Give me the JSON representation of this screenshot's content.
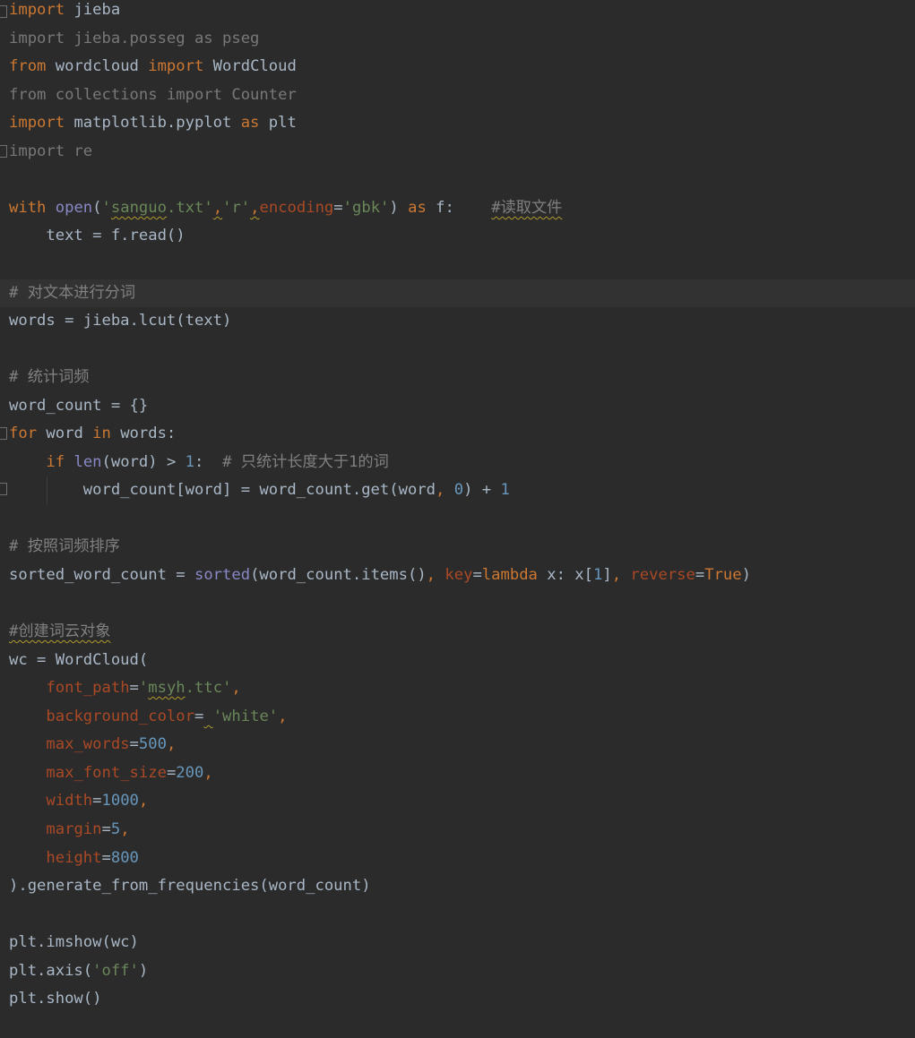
{
  "editor": {
    "colors": {
      "background": "#2b2b2b",
      "current_line": "#323232",
      "keyword": "#cc7832",
      "string": "#6a8759",
      "number": "#6897bb",
      "comment": "#808080",
      "builtin": "#8888c6",
      "param": "#aa4926",
      "default": "#a9b7c6"
    },
    "lines": [
      {
        "tokens": [
          {
            "t": "import",
            "c": "kw"
          },
          {
            "t": " jieba",
            "c": "def"
          }
        ]
      },
      {
        "tokens": [
          {
            "t": "import jieba.posseg as pseg",
            "c": "gray"
          }
        ]
      },
      {
        "tokens": [
          {
            "t": "from",
            "c": "kw"
          },
          {
            "t": " wordcloud ",
            "c": "def"
          },
          {
            "t": "import",
            "c": "kw"
          },
          {
            "t": " WordCloud",
            "c": "def"
          }
        ]
      },
      {
        "tokens": [
          {
            "t": "from collections import Counter",
            "c": "gray"
          }
        ]
      },
      {
        "tokens": [
          {
            "t": "import",
            "c": "kw"
          },
          {
            "t": " matplotlib.pyplot ",
            "c": "def"
          },
          {
            "t": "as",
            "c": "kw"
          },
          {
            "t": " plt",
            "c": "def"
          }
        ]
      },
      {
        "tokens": [
          {
            "t": "import re",
            "c": "gray"
          }
        ]
      },
      {
        "tokens": []
      },
      {
        "tokens": [
          {
            "t": "with",
            "c": "kw"
          },
          {
            "t": " ",
            "c": "def"
          },
          {
            "t": "open",
            "c": "builtin"
          },
          {
            "t": "(",
            "c": "def"
          },
          {
            "t": "'",
            "c": "str"
          },
          {
            "t": "sanguo",
            "c": "str",
            "s": true
          },
          {
            "t": ".txt'",
            "c": "str"
          },
          {
            "t": ",",
            "c": "kw",
            "s": true
          },
          {
            "t": "'r'",
            "c": "str"
          },
          {
            "t": ",",
            "c": "kw",
            "s": true
          },
          {
            "t": "encoding",
            "c": "param"
          },
          {
            "t": "=",
            "c": "def"
          },
          {
            "t": "'gbk'",
            "c": "str"
          },
          {
            "t": ") ",
            "c": "def"
          },
          {
            "t": "as",
            "c": "kw"
          },
          {
            "t": " f:    ",
            "c": "def"
          },
          {
            "t": "#读取文件",
            "c": "com",
            "s": true
          }
        ]
      },
      {
        "tokens": [
          {
            "t": "    text = f.read()",
            "c": "def"
          }
        ]
      },
      {
        "tokens": []
      },
      {
        "tokens": [
          {
            "t": "# 对文本进行分词",
            "c": "com"
          }
        ],
        "current": true
      },
      {
        "tokens": [
          {
            "t": "words = jieba.lcut(text)",
            "c": "def"
          }
        ]
      },
      {
        "tokens": []
      },
      {
        "tokens": [
          {
            "t": "# 统计词频",
            "c": "com"
          }
        ]
      },
      {
        "tokens": [
          {
            "t": "word_count = {}",
            "c": "def"
          }
        ]
      },
      {
        "tokens": [
          {
            "t": "for",
            "c": "kw"
          },
          {
            "t": " word ",
            "c": "def"
          },
          {
            "t": "in",
            "c": "kw"
          },
          {
            "t": " words:",
            "c": "def"
          }
        ]
      },
      {
        "tokens": [
          {
            "t": "    ",
            "c": "def"
          },
          {
            "t": "if",
            "c": "kw"
          },
          {
            "t": " ",
            "c": "def"
          },
          {
            "t": "len",
            "c": "builtin"
          },
          {
            "t": "(word) > ",
            "c": "def"
          },
          {
            "t": "1",
            "c": "num"
          },
          {
            "t": ":  ",
            "c": "def"
          },
          {
            "t": "# 只统计长度大于1的词",
            "c": "com"
          }
        ]
      },
      {
        "tokens": [
          {
            "t": "        word_count[word] = word_count.get(word",
            "c": "def"
          },
          {
            "t": ",",
            "c": "kw"
          },
          {
            "t": " ",
            "c": "def"
          },
          {
            "t": "0",
            "c": "num"
          },
          {
            "t": ") + ",
            "c": "def"
          },
          {
            "t": "1",
            "c": "num"
          }
        ]
      },
      {
        "tokens": []
      },
      {
        "tokens": [
          {
            "t": "# 按照词频排序",
            "c": "com"
          }
        ]
      },
      {
        "tokens": [
          {
            "t": "sorted_word_count = ",
            "c": "def"
          },
          {
            "t": "sorted",
            "c": "builtin"
          },
          {
            "t": "(word_count.items()",
            "c": "def"
          },
          {
            "t": ",",
            "c": "kw"
          },
          {
            "t": " ",
            "c": "def"
          },
          {
            "t": "key",
            "c": "param"
          },
          {
            "t": "=",
            "c": "def"
          },
          {
            "t": "lambda",
            "c": "kw"
          },
          {
            "t": " x: x[",
            "c": "def"
          },
          {
            "t": "1",
            "c": "num"
          },
          {
            "t": "]",
            "c": "def"
          },
          {
            "t": ",",
            "c": "kw"
          },
          {
            "t": " ",
            "c": "def"
          },
          {
            "t": "reverse",
            "c": "param"
          },
          {
            "t": "=",
            "c": "def"
          },
          {
            "t": "True",
            "c": "kw"
          },
          {
            "t": ")",
            "c": "def"
          }
        ]
      },
      {
        "tokens": []
      },
      {
        "tokens": [
          {
            "t": "#创建词云对象",
            "c": "com",
            "s": true
          }
        ]
      },
      {
        "tokens": [
          {
            "t": "wc = WordCloud(",
            "c": "def"
          }
        ]
      },
      {
        "tokens": [
          {
            "t": "    ",
            "c": "def"
          },
          {
            "t": "font_path",
            "c": "param"
          },
          {
            "t": "=",
            "c": "def"
          },
          {
            "t": "'",
            "c": "str"
          },
          {
            "t": "msyh",
            "c": "str",
            "s": true
          },
          {
            "t": ".ttc'",
            "c": "str"
          },
          {
            "t": ",",
            "c": "kw"
          }
        ]
      },
      {
        "tokens": [
          {
            "t": "    ",
            "c": "def"
          },
          {
            "t": "background_color",
            "c": "param"
          },
          {
            "t": "=",
            "c": "def"
          },
          {
            "t": " ",
            "c": "def",
            "s": true
          },
          {
            "t": "'white'",
            "c": "str"
          },
          {
            "t": ",",
            "c": "kw"
          }
        ]
      },
      {
        "tokens": [
          {
            "t": "    ",
            "c": "def"
          },
          {
            "t": "max_words",
            "c": "param"
          },
          {
            "t": "=",
            "c": "def"
          },
          {
            "t": "500",
            "c": "num"
          },
          {
            "t": ",",
            "c": "kw"
          }
        ]
      },
      {
        "tokens": [
          {
            "t": "    ",
            "c": "def"
          },
          {
            "t": "max_font_size",
            "c": "param"
          },
          {
            "t": "=",
            "c": "def"
          },
          {
            "t": "200",
            "c": "num"
          },
          {
            "t": ",",
            "c": "kw"
          }
        ]
      },
      {
        "tokens": [
          {
            "t": "    ",
            "c": "def"
          },
          {
            "t": "width",
            "c": "param"
          },
          {
            "t": "=",
            "c": "def"
          },
          {
            "t": "1000",
            "c": "num"
          },
          {
            "t": ",",
            "c": "kw"
          }
        ]
      },
      {
        "tokens": [
          {
            "t": "    ",
            "c": "def"
          },
          {
            "t": "margin",
            "c": "param"
          },
          {
            "t": "=",
            "c": "def"
          },
          {
            "t": "5",
            "c": "num"
          },
          {
            "t": ",",
            "c": "kw"
          }
        ]
      },
      {
        "tokens": [
          {
            "t": "    ",
            "c": "def"
          },
          {
            "t": "height",
            "c": "param"
          },
          {
            "t": "=",
            "c": "def"
          },
          {
            "t": "800",
            "c": "num"
          }
        ]
      },
      {
        "tokens": [
          {
            "t": ").generate_from_frequencies(word_count)",
            "c": "def"
          }
        ]
      },
      {
        "tokens": []
      },
      {
        "tokens": [
          {
            "t": "plt.imshow(wc)",
            "c": "def"
          }
        ]
      },
      {
        "tokens": [
          {
            "t": "plt.axis(",
            "c": "def"
          },
          {
            "t": "'off'",
            "c": "str"
          },
          {
            "t": ")",
            "c": "def"
          }
        ]
      },
      {
        "tokens": [
          {
            "t": "plt.show()",
            "c": "def"
          }
        ]
      }
    ]
  }
}
